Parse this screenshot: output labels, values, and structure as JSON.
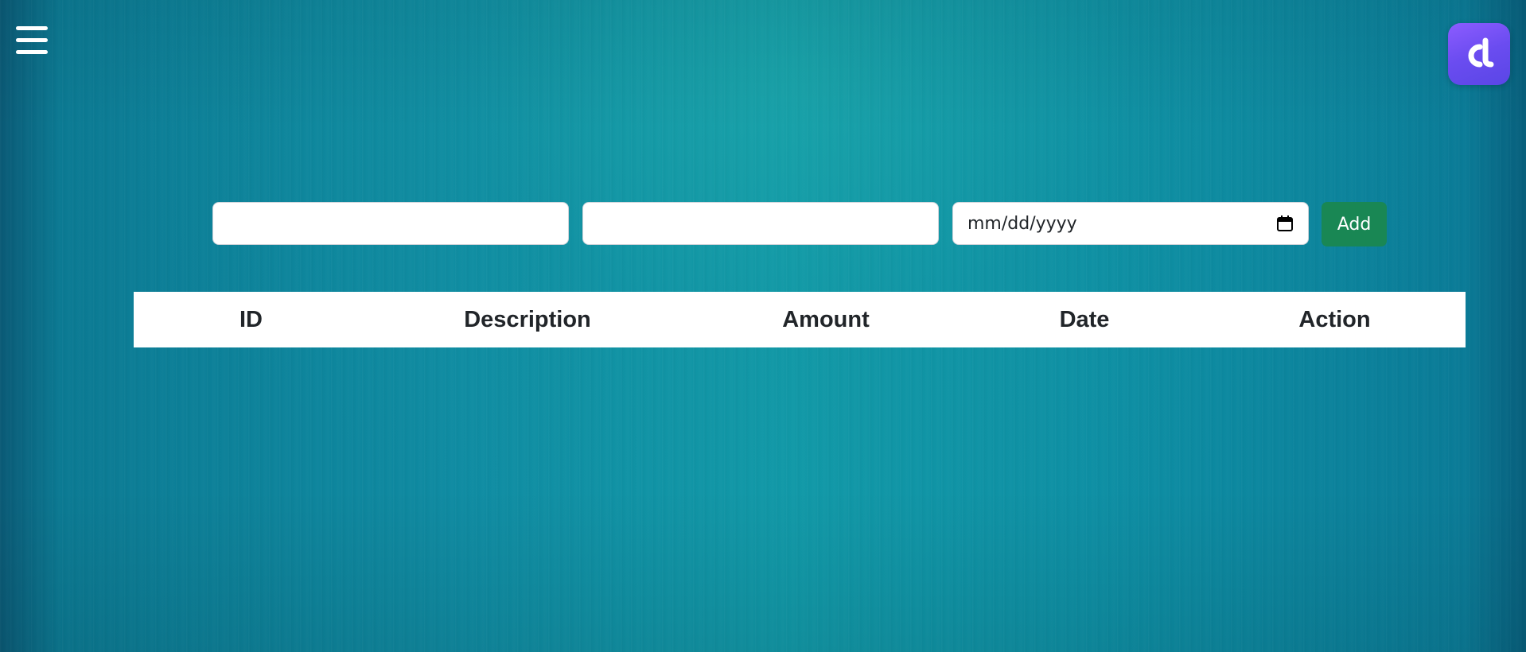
{
  "header": {
    "menu_icon": "hamburger-menu-icon",
    "logo_icon": "app-logo-icon"
  },
  "form": {
    "description_placeholder": "",
    "amount_placeholder": "",
    "date_placeholder": "mm/dd/yyyy",
    "calendar_icon": "calendar-icon",
    "add_label": "Add",
    "add_color": "#198754"
  },
  "table": {
    "columns": [
      "ID",
      "Description",
      "Amount",
      "Date",
      "Action"
    ],
    "rows": []
  },
  "colors": {
    "background": "#0f8ba2",
    "logo": "#6a4cf0"
  }
}
